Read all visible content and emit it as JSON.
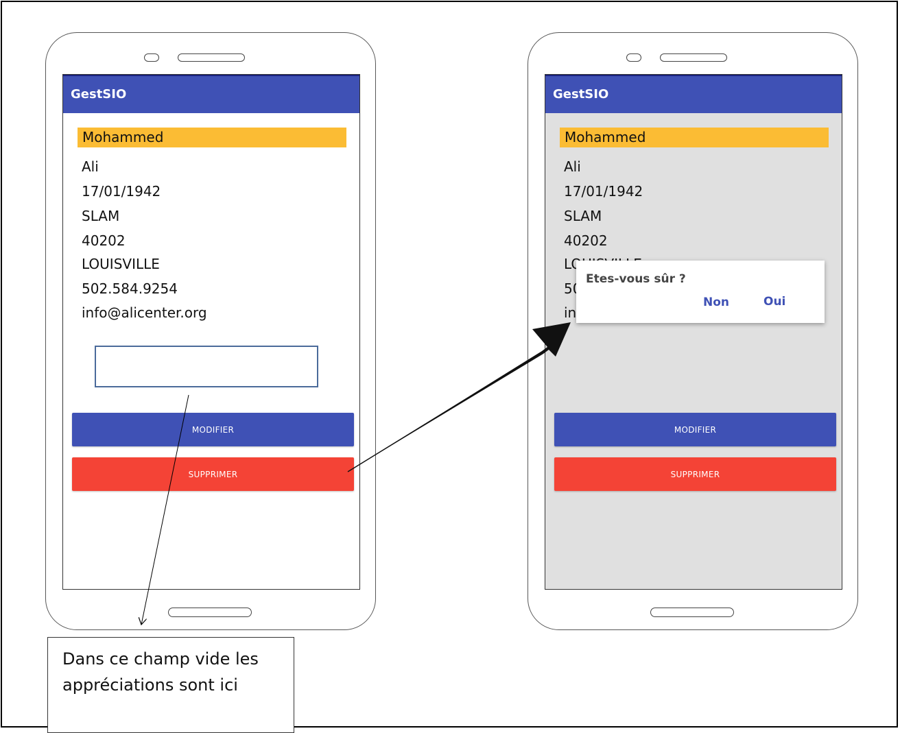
{
  "app": {
    "title": "GestSIO"
  },
  "record": {
    "first_name": "Mohammed",
    "last_name": "Ali",
    "birth_date": "17/01/1942",
    "option": "SLAM",
    "postal_code": "40202",
    "city": "LOUISVILLE",
    "phone": "502.584.9254",
    "email": "info@alicenter.org"
  },
  "actions": {
    "modify_label": "MODIFIER",
    "delete_label": "SUPPRIMER"
  },
  "dialog": {
    "title": "Etes-vous sûr ?",
    "no_label": "Non",
    "yes_label": "Oui"
  },
  "annotation": {
    "line1": "Dans ce champ vide les",
    "line2": "appréciations sont ici"
  },
  "colors": {
    "appbar": "#3f51b5",
    "name_highlight": "#fbbc34",
    "modify_button": "#3f51b5",
    "delete_button": "#f44336",
    "dimmed_screen": "#e0e0e0"
  }
}
